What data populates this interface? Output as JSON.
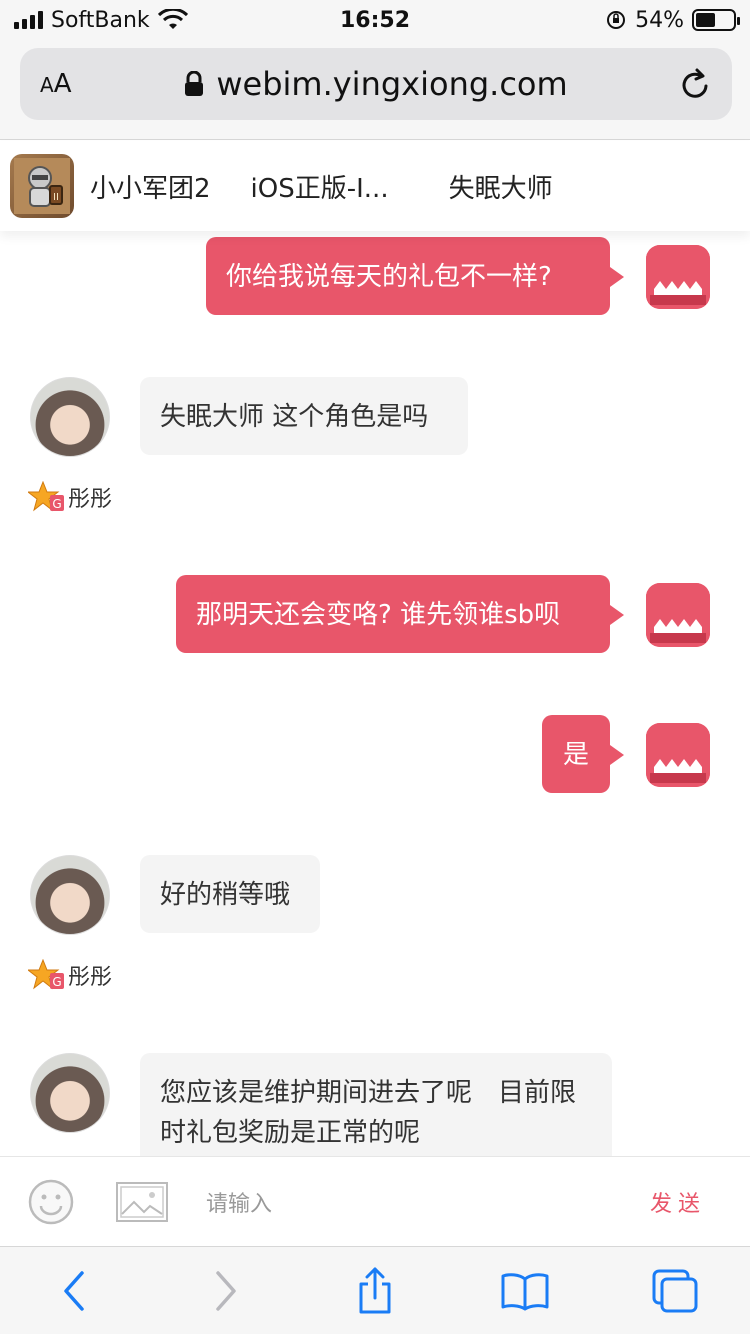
{
  "status_bar": {
    "carrier": "SoftBank",
    "time": "16:52",
    "battery_percent_text": "54%",
    "battery_level": 0.54
  },
  "browser": {
    "text_size_label": "AA",
    "url": "webim.yingxiong.com"
  },
  "game_tabs": [
    {
      "label": "小小军团2"
    },
    {
      "label": "iOS正版-I..."
    },
    {
      "label": "失眠大师"
    }
  ],
  "messages": [
    {
      "side": "me",
      "text": "你给我说每天的礼包不一样?"
    },
    {
      "side": "them",
      "text": "失眠大师 这个角色是吗",
      "name": "彤彤"
    },
    {
      "side": "me",
      "text": "那明天还会变咯? 谁先领谁sb呗"
    },
    {
      "side": "me",
      "text": "是"
    },
    {
      "side": "them",
      "text": "好的稍等哦",
      "name": "彤彤"
    },
    {
      "side": "them",
      "text": "您应该是维护期间进去了呢　目前限时礼包奖励是正常的呢"
    }
  ],
  "input": {
    "placeholder": "请输入",
    "send_label": "发送"
  },
  "colors": {
    "accent": "#e8566a",
    "bubble_other": "#f4f4f4",
    "toolbar_blue": "#1a7cf5"
  },
  "icons": [
    "signal-icon",
    "wifi-icon",
    "lock-rotation-icon",
    "battery-icon",
    "lock-icon",
    "reload-icon",
    "emoji-icon",
    "image-icon",
    "back-icon",
    "forward-icon",
    "share-icon",
    "bookmarks-icon",
    "tabs-icon"
  ]
}
